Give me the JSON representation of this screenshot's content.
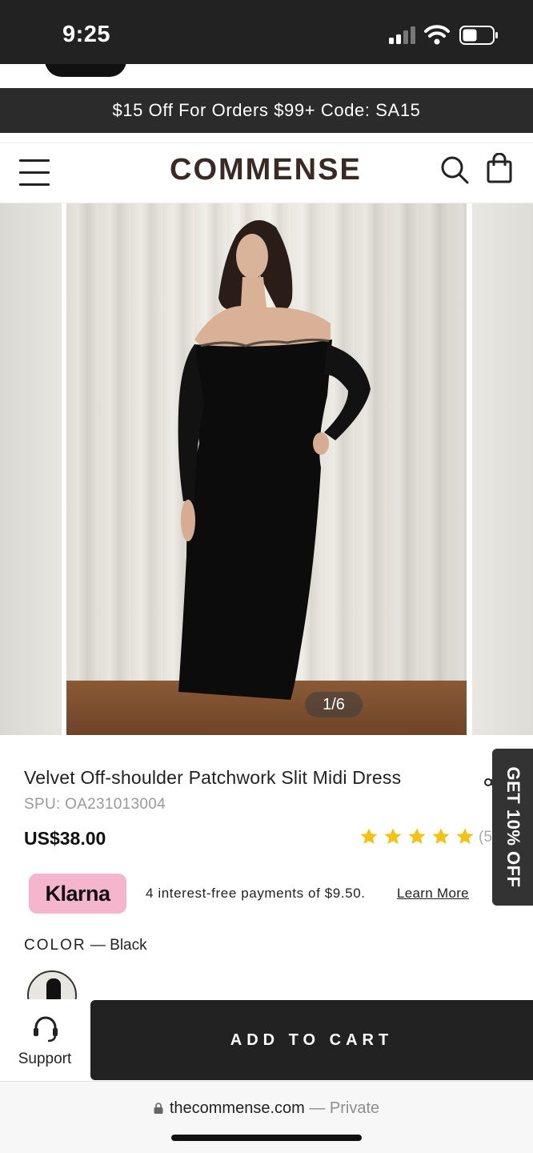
{
  "status_bar": {
    "time": "9:25"
  },
  "promo_banner": {
    "text": "$15 Off For Orders $99+ Code: SA15"
  },
  "header": {
    "logo": "COMMENSE"
  },
  "gallery": {
    "counter": "1/6"
  },
  "product": {
    "title": "Velvet Off-shoulder Patchwork Slit Midi Dress",
    "spu": "SPU: OA231013004",
    "price": "US$38.00",
    "rating": 5,
    "rating_max": 5,
    "review_count": "(5)"
  },
  "side_tab": {
    "label": "GET 10% OFF"
  },
  "klarna": {
    "badge": "Klarna",
    "text": "4 interest-free payments of $9.50.",
    "link": "Learn More"
  },
  "color": {
    "label": "COLOR",
    "separator": " — ",
    "value": "Black"
  },
  "action_bar": {
    "support_label": "Support",
    "add_to_cart": "ADD TO CART"
  },
  "browser": {
    "url": "thecommense.com",
    "privacy": "— Private"
  },
  "colors": {
    "status_bg": "#222222",
    "promo_bg": "#2b2b2b",
    "logo": "#3a2a25",
    "star": "#f5c211",
    "klarna_pink": "#f5b5cc",
    "cta_bg": "#222222"
  },
  "icons": [
    "signal-icon",
    "wifi-icon",
    "battery-icon",
    "menu-icon",
    "search-icon",
    "bag-icon",
    "share-icon",
    "star-icon",
    "headset-icon",
    "lock-icon"
  ]
}
